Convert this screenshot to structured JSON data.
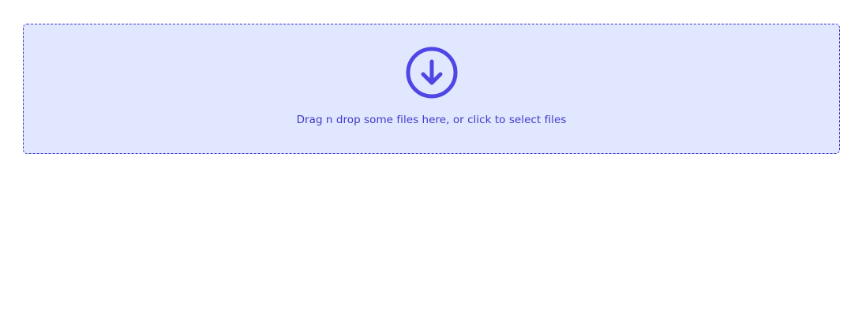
{
  "dropzone": {
    "icon": "download-circle-icon",
    "label": "Drag n drop some files here, or click to select files"
  },
  "colors": {
    "zone_background": "#e0e7ff",
    "accent": "#4f46e5",
    "text": "#4338ca"
  }
}
